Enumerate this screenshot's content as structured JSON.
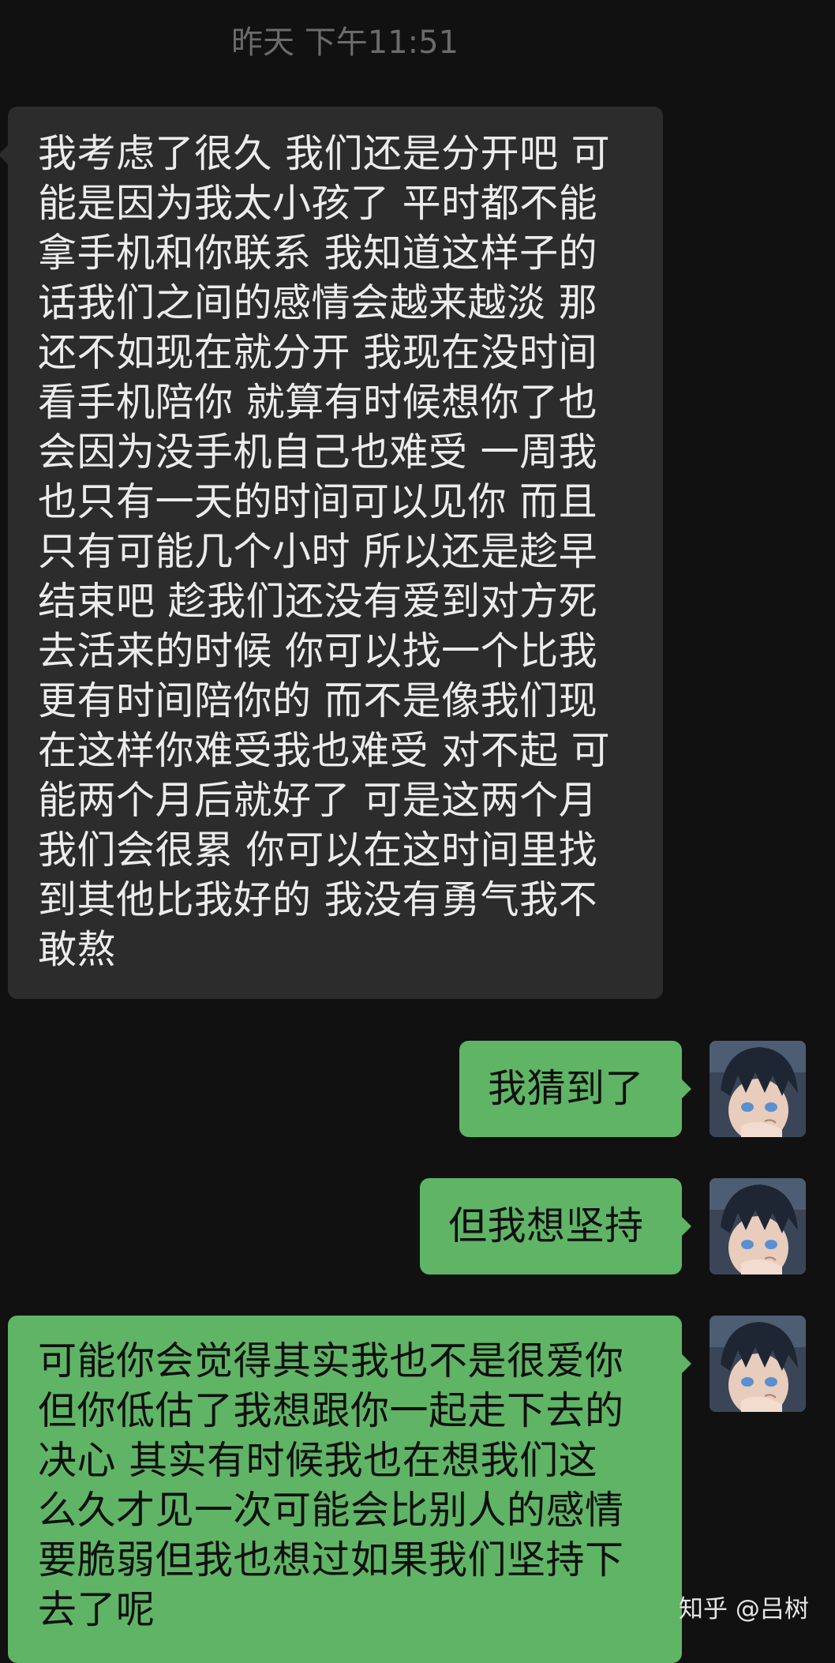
{
  "chat": {
    "timestamp": "昨天 下午11:51",
    "messages": [
      {
        "side": "received",
        "text": "我考虑了很久 我们还是分开吧 可\n能是因为我太小孩了 平时都不能\n拿手机和你联系 我知道这样子的\n话我们之间的感情会越来越淡 那\n还不如现在就分开 我现在没时间\n看手机陪你 就算有时候想你了也\n会因为没手机自己也难受 一周我\n也只有一天的时间可以见你 而且\n只有可能几个小时 所以还是趁早\n结束吧 趁我们还没有爱到对方死\n去活来的时候 你可以找一个比我\n更有时间陪你的 而不是像我们现\n在这样你难受我也难受 对不起 可\n能两个月后就好了 可是这两个月\n我们会很累 你可以在这时间里找\n到其他比我好的 我没有勇气我不\n敢熬"
      },
      {
        "side": "sent",
        "text": "我猜到了"
      },
      {
        "side": "sent",
        "text": "但我想坚持"
      },
      {
        "side": "sent",
        "text": "可能你会觉得其实我也不是很爱你\n但你低估了我想跟你一起走下去的\n决心 其实有时候我也在想我们这\n么久才见一次可能会比别人的感情\n要脆弱但我也想过如果我们坚持下\n去了呢"
      }
    ]
  },
  "watermark": "知乎 @吕树",
  "colors": {
    "background": "#111111",
    "received_bubble": "#2c2c2c",
    "sent_bubble": "#5fb565"
  },
  "icons": {
    "avatar": "anime-boy-avatar"
  }
}
